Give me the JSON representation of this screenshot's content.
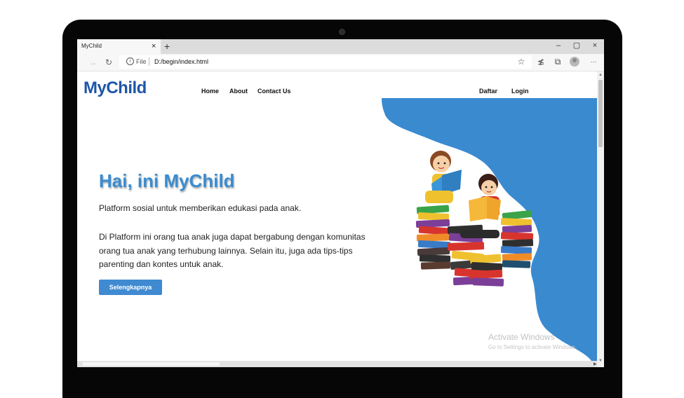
{
  "browser": {
    "tab_title": "MyChild",
    "tab_close": "×",
    "new_tab": "+",
    "window_buttons": {
      "minimize": "–",
      "maximize": "▢",
      "close": "×"
    },
    "back_icon": "→",
    "reload_icon": "↻",
    "info_icon": "i",
    "url_scheme_label": "File",
    "url": "D:/begin/index.html",
    "toolbar_icons": {
      "favorite": "☆",
      "favorites_list": "≴",
      "collections": "⧉",
      "more": "···"
    }
  },
  "site": {
    "brand": "MyChild",
    "nav": [
      "Home",
      "About",
      "Contact Us"
    ],
    "auth": {
      "register": "Daftar",
      "login": "Login"
    }
  },
  "hero": {
    "title": "Hai, ini MyChild",
    "subtitle": "Platform sosial untuk memberikan edukasi pada anak.",
    "description": "Di Platform ini orang tua anak juga dapat bergabung dengan komunitas orang tua anak yang terhubung lainnya. Selain itu, juga ada tips-tips parenting dan kontes untuk anak.",
    "cta": "Selengkapnya"
  },
  "watermark": {
    "line1": "Activate Windows",
    "line2": "Go to Settings to activate Windows."
  },
  "colors": {
    "brand": "#1e56a8",
    "accent": "#3f8ad1",
    "hero_blob": "#3a8ad0"
  }
}
